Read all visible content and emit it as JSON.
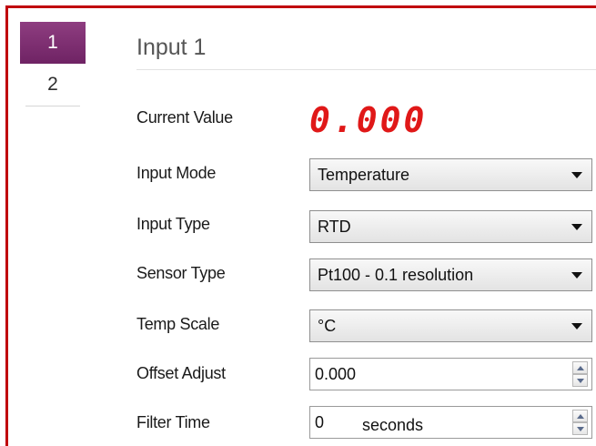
{
  "tabs": [
    {
      "label": "1",
      "active": true
    },
    {
      "label": "2",
      "active": false
    }
  ],
  "section_title": "Input 1",
  "current_value": {
    "label": "Current Value",
    "value": "0.000"
  },
  "fields": {
    "input_mode": {
      "label": "Input Mode",
      "value": "Temperature"
    },
    "input_type": {
      "label": "Input Type",
      "value": "RTD"
    },
    "sensor_type": {
      "label": "Sensor Type",
      "value": "Pt100 - 0.1 resolution"
    },
    "temp_scale": {
      "label": "Temp Scale",
      "value": "°C"
    },
    "offset_adjust": {
      "label": "Offset Adjust",
      "value": "0.000"
    },
    "filter_time": {
      "label": "Filter Time",
      "value": "0",
      "unit": "seconds"
    }
  },
  "colors": {
    "frame_border": "#c0000c",
    "active_tab": "#7e2d72",
    "lcd_digits": "#e01818"
  }
}
